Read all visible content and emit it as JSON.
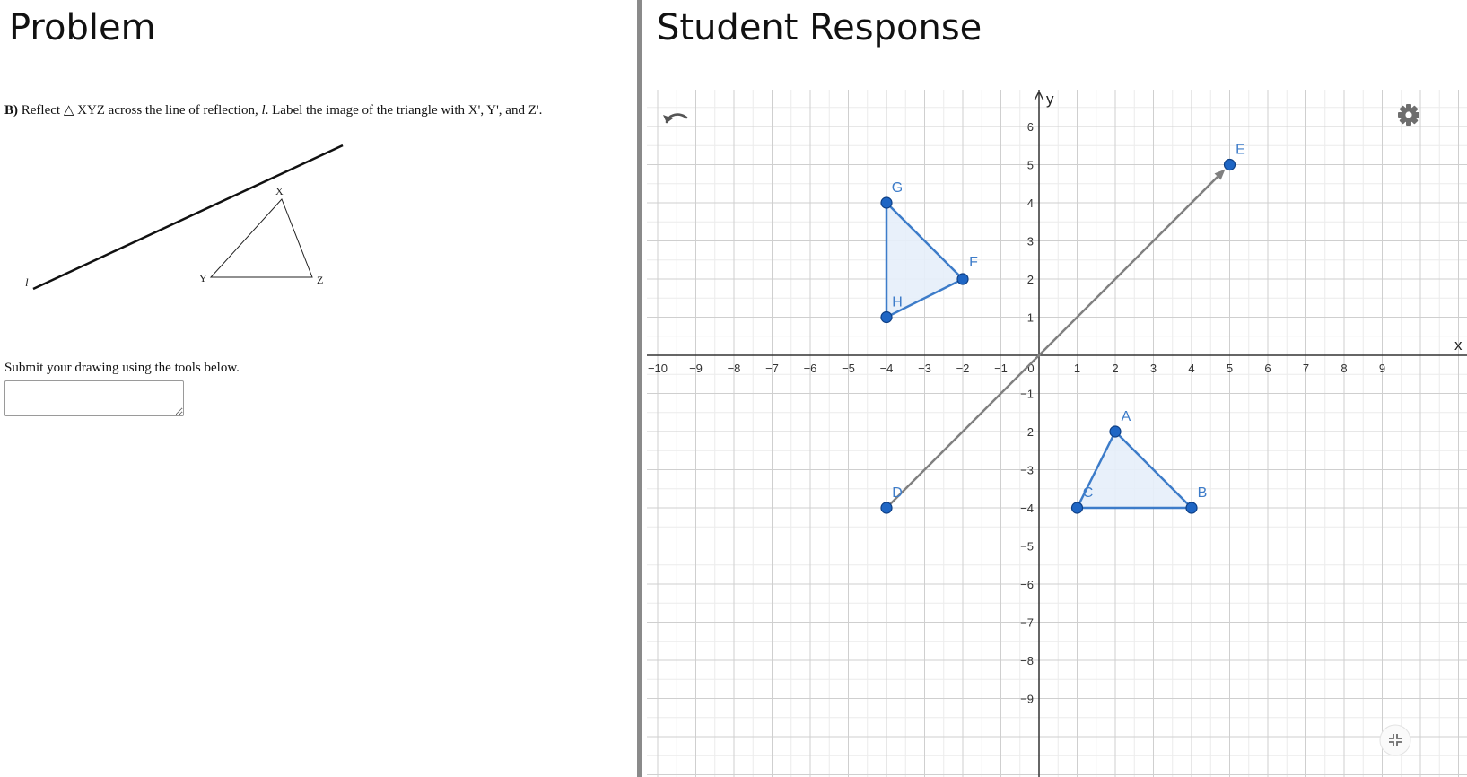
{
  "left": {
    "title": "Problem",
    "question": {
      "part": "B)",
      "text_before_shape": " Reflect ",
      "shape_symbol": "△",
      "text_after_shape": " XYZ across the line of reflection, ",
      "line_name": "l",
      "text_end": ". Label the image of the triangle with X', Y', and Z'."
    },
    "figure_labels": {
      "line": "l",
      "x": "X",
      "y": "Y",
      "z": "Z"
    },
    "submit_prompt": "Submit your drawing using the tools below.",
    "answer_value": ""
  },
  "right": {
    "title": "Student Response",
    "axis_names": {
      "x": "x",
      "y": "y"
    },
    "x_ticks": [
      "−10",
      "−9",
      "−8",
      "−7",
      "−6",
      "−5",
      "−4",
      "−3",
      "−2",
      "−1",
      "0",
      "1",
      "2",
      "3",
      "4",
      "5",
      "6",
      "7",
      "8",
      "9"
    ],
    "y_ticks": [
      "6",
      "5",
      "4",
      "3",
      "2",
      "1",
      "−1",
      "−2",
      "−3",
      "−4",
      "−5",
      "−6",
      "−7",
      "−8",
      "−9"
    ],
    "points": [
      {
        "label": "A",
        "x": 2,
        "y": -2
      },
      {
        "label": "B",
        "x": 4,
        "y": -4
      },
      {
        "label": "C",
        "x": 1,
        "y": -4
      },
      {
        "label": "D",
        "x": -4,
        "y": -4
      },
      {
        "label": "E",
        "x": 5,
        "y": 5
      },
      {
        "label": "F",
        "x": -2,
        "y": 2
      },
      {
        "label": "G",
        "x": -4,
        "y": 4
      },
      {
        "label": "H",
        "x": -4,
        "y": 1
      }
    ],
    "triangles": [
      [
        "A",
        "B",
        "C"
      ],
      [
        "F",
        "G",
        "H"
      ]
    ],
    "vector": {
      "from": "D",
      "to": "E"
    },
    "colors": {
      "accent": "#3d7cc9",
      "point_fill": "#1f66c4",
      "vector": "#808080",
      "triangle_fill": "#e6eef9"
    },
    "icons": [
      "undo-icon",
      "settings-gear-icon",
      "exit-fullscreen-icon"
    ]
  }
}
